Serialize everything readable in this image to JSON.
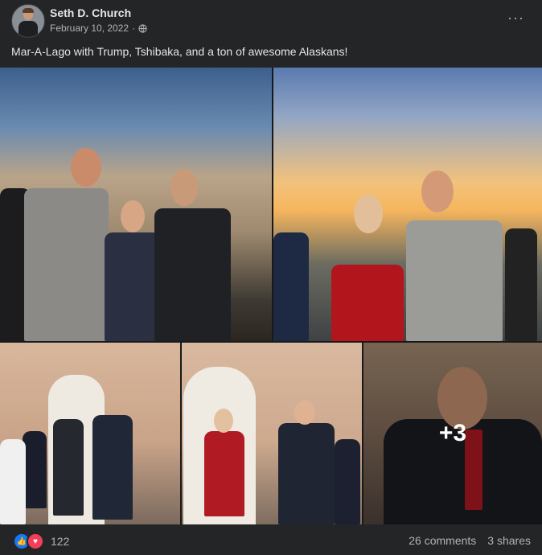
{
  "post": {
    "author": "Seth D. Church",
    "date": "February 10, 2022",
    "separator": "·",
    "caption": "Mar-A-Lago with Trump, Tshibaka, and a ton of awesome Alaskans!",
    "more_label": "···"
  },
  "photos": {
    "more_count": "+3"
  },
  "footer": {
    "reaction_count": "122",
    "comments": "26 comments",
    "shares": "3 shares",
    "like_glyph": "👍",
    "love_glyph": "♥"
  },
  "colors": {
    "background": "#242526",
    "like": "#1877f2",
    "love": "#f33e58"
  }
}
